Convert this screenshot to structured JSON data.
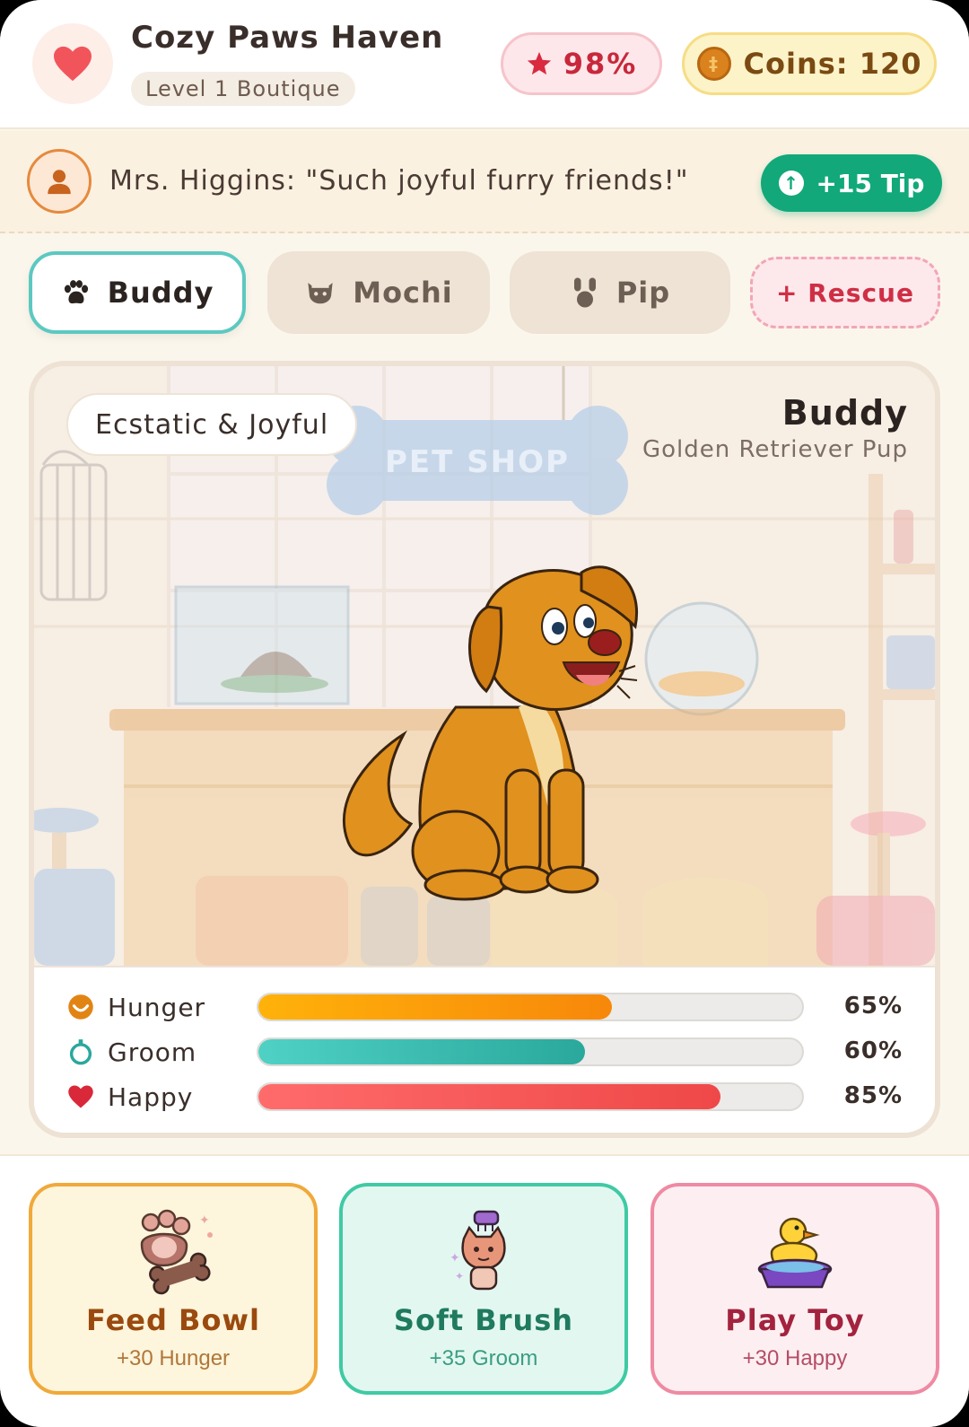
{
  "header": {
    "shop_name": "Cozy Paws Haven",
    "level": "Level 1 Boutique",
    "rating": "98%",
    "coins": "Coins: 120"
  },
  "customer": {
    "quote": "Mrs. Higgins: \"Such joyful furry friends!\"",
    "tip_label": "+15 Tip"
  },
  "tabs": [
    {
      "label": "Buddy",
      "icon": "paw-icon",
      "active": true
    },
    {
      "label": "Mochi",
      "icon": "cat-icon",
      "active": false
    },
    {
      "label": "Pip",
      "icon": "bunny-icon",
      "active": false
    }
  ],
  "rescue_label": "+ Rescue",
  "scene": {
    "sign": "PET SHOP",
    "mood": "Ecstatic & Joyful",
    "pet_name": "Buddy",
    "pet_breed": "Golden Retriever Pup"
  },
  "stats": [
    {
      "label": "Hunger",
      "value": "65%",
      "level": 0.65,
      "icon": "hunger-icon",
      "color": "#f5a114"
    },
    {
      "label": "Groom",
      "value": "60%",
      "level": 0.6,
      "icon": "groom-icon",
      "color": "#3dbfb2"
    },
    {
      "label": "Happy",
      "value": "85%",
      "level": 0.85,
      "icon": "heart-icon",
      "color": "#f0505a"
    }
  ],
  "actions": [
    {
      "title": "Feed Bowl",
      "subtitle": "+30 Hunger",
      "icon": "paw-bone-icon"
    },
    {
      "title": "Soft Brush",
      "subtitle": "+35 Groom",
      "icon": "brush-cat-icon"
    },
    {
      "title": "Play Toy",
      "subtitle": "+30 Happy",
      "icon": "rubber-duck-icon"
    }
  ]
}
